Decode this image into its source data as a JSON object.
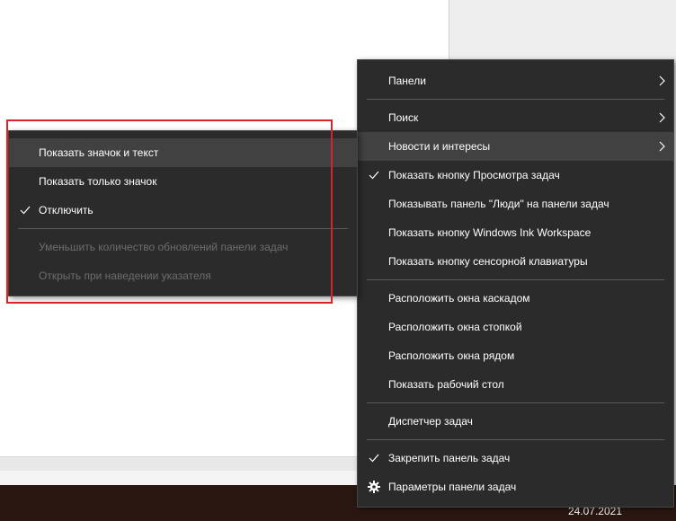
{
  "taskbar": {
    "date": "24.07.2021"
  },
  "main_menu": {
    "panels": "Панели",
    "search": "Поиск",
    "news": "Новости и интересы",
    "show_task_view": "Показать кнопку Просмотра задач",
    "show_people": "Показывать панель \"Люди\" на панели задач",
    "show_ink": "Показать кнопку Windows Ink Workspace",
    "show_keyboard": "Показать кнопку сенсорной клавиатуры",
    "cascade": "Расположить окна каскадом",
    "stacked": "Расположить окна стопкой",
    "side_by_side": "Расположить окна рядом",
    "show_desktop": "Показать рабочий стол",
    "task_manager": "Диспетчер задач",
    "lock_taskbar": "Закрепить панель задач",
    "taskbar_settings": "Параметры панели задач"
  },
  "sub_menu": {
    "show_icon_and_text": "Показать значок и текст",
    "show_icon_only": "Показать только значок",
    "turn_off": "Отключить",
    "reduce_updates": "Уменьшить количество обновлений панели задач",
    "open_on_hover": "Открыть при наведении указателя"
  },
  "colors": {
    "menu_bg": "#2b2b2b",
    "highlight": "#414141",
    "disabled_text": "#6d6d6d",
    "frame": "#d8232a",
    "taskbar": "#2b1711"
  }
}
